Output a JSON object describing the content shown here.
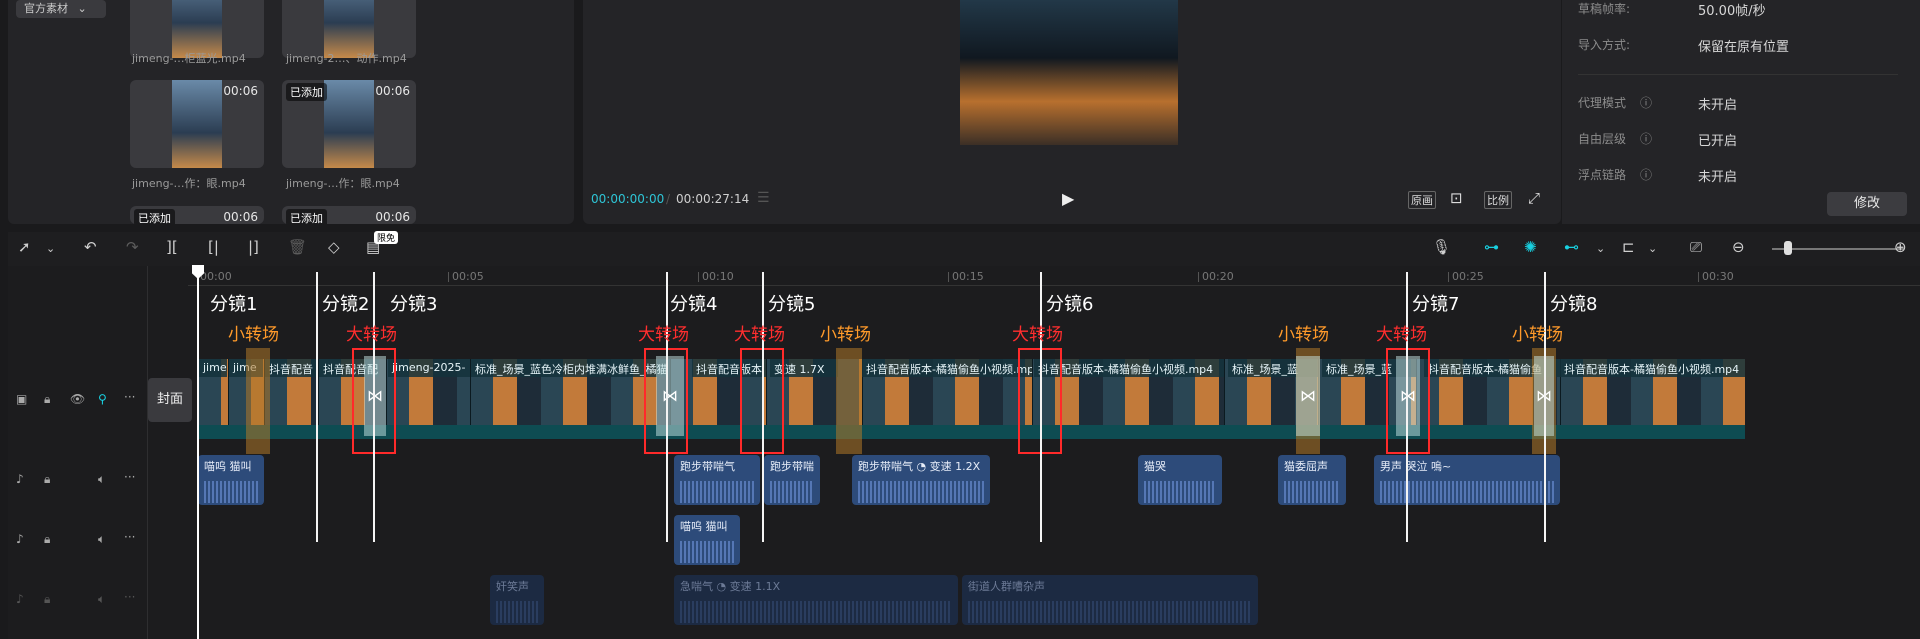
{
  "media": {
    "tag_label": "官方素材",
    "items": [
      {
        "label": "jimeng-…柜蓝光.mp4",
        "duration": "",
        "tag": ""
      },
      {
        "label": "jimeng-2…、动作.mp4",
        "duration": "",
        "tag": ""
      },
      {
        "label": "jimeng-…作：眼.mp4",
        "duration": "00:06",
        "tag": ""
      },
      {
        "label": "jimeng-…作：眼.mp4",
        "duration": "00:06",
        "tag": "已添加"
      },
      {
        "label": "",
        "duration": "00:06",
        "tag": "已添加"
      },
      {
        "label": "",
        "duration": "00:06",
        "tag": "已添加"
      }
    ]
  },
  "preview": {
    "current_time": "00:00:00:00",
    "total_time": "00:00:27:14",
    "btn_original": "原画",
    "btn_ratio": "比例"
  },
  "properties": {
    "rows": [
      {
        "label": "草稿帧率:",
        "value": "50.00帧/秒"
      },
      {
        "label": "导入方式:",
        "value": "保留在原有位置"
      },
      {
        "label": "代理模式",
        "value": "未开启"
      },
      {
        "label": "自由层级",
        "value": "已开启"
      },
      {
        "label": "浮点链路",
        "value": "未开启"
      }
    ],
    "modify_label": "修改"
  },
  "toolbar": {
    "limited_badge": "限免",
    "icons": [
      "select-icon",
      "undo-icon",
      "redo-icon",
      "split-icon",
      "split-left-icon",
      "split-right-icon",
      "delete-icon",
      "shield-icon",
      "text-icon",
      "mic-icon",
      "link-main-icon",
      "magic-link-icon",
      "link-preview-icon",
      "align-icon",
      "screenshot-icon",
      "zoom-out-icon",
      "zoom-in-icon"
    ]
  },
  "timeline": {
    "cover_label": "封面",
    "ruler": [
      "00:00",
      "00:05",
      "00:10",
      "00:15",
      "00:20",
      "00:25",
      "00:30"
    ],
    "cuts": [
      "分镜1",
      "分镜2",
      "分镜3",
      "分镜4",
      "分镜5",
      "分镜6",
      "分镜7",
      "分镜8"
    ],
    "transitions": [
      {
        "label": "小转场",
        "kind": "small"
      },
      {
        "label": "大转场",
        "kind": "big"
      },
      {
        "label": "大转场",
        "kind": "big"
      },
      {
        "label": "大转场",
        "kind": "big"
      },
      {
        "label": "小转场",
        "kind": "small"
      },
      {
        "label": "大转场",
        "kind": "big"
      },
      {
        "label": "小转场",
        "kind": "small"
      },
      {
        "label": "大转场",
        "kind": "big"
      },
      {
        "label": "小转场",
        "kind": "small"
      }
    ],
    "video_clips": [
      {
        "label": "jime"
      },
      {
        "label": "jime"
      },
      {
        "label": "抖音配音"
      },
      {
        "label": "抖音配音配"
      },
      {
        "label": "jimeng-2025-"
      },
      {
        "label": "标准_场景_蓝色冷柜内堆满冰鲜鱼_橘猫"
      },
      {
        "label": "抖音配音版本"
      },
      {
        "label": "变速 1.7X"
      },
      {
        "label": "抖音配音版本-橘猫偷鱼小视频.mp4"
      },
      {
        "label": "抖音配音版本-橘猫偷鱼小视频.mp4"
      },
      {
        "label": "标准_场景_蓝"
      },
      {
        "label": "标准_场景_蓝"
      },
      {
        "label": "抖音配音版本-橘猫偷鱼"
      },
      {
        "label": "抖音配音版本-橘猫偷鱼小视频.mp4"
      }
    ],
    "audio_track1": [
      {
        "label": "喵呜 猫叫"
      },
      {
        "label": "跑步带喘气"
      },
      {
        "label": "跑步带喘"
      },
      {
        "label": "跑步带喘气",
        "speed": "变速 1.2X"
      },
      {
        "label": "猫哭"
      },
      {
        "label": "猫委屈声"
      },
      {
        "label": "男声 哭泣 嗚~"
      }
    ],
    "audio_track2": [
      {
        "label": "喵呜 猫叫"
      }
    ],
    "audio_track3": [
      {
        "label": "奸笑声"
      },
      {
        "label": "急喘气",
        "speed": "变速 1.1X"
      },
      {
        "label": "街道人群嘈杂声"
      }
    ]
  }
}
